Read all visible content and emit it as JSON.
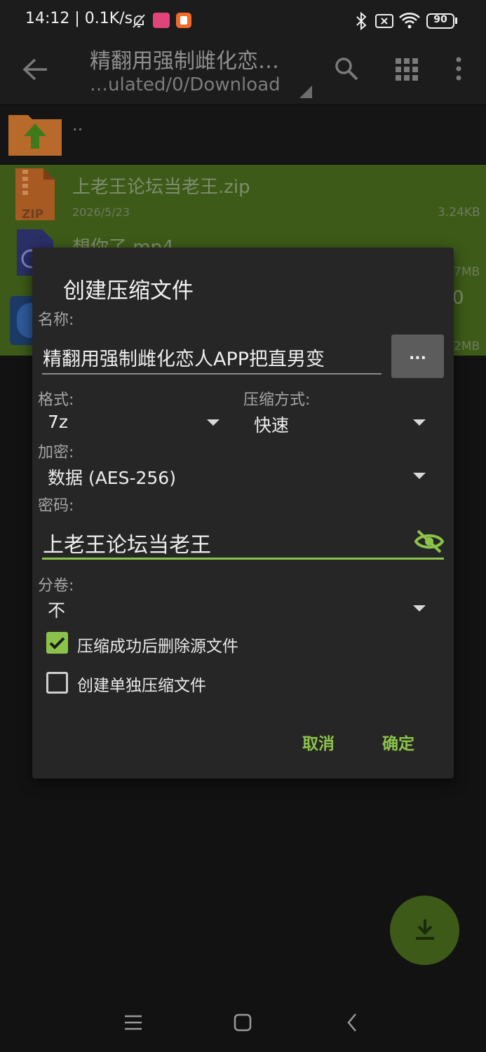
{
  "status_bar": {
    "time_speed": "14:12 | 0.1K/s",
    "battery": "90",
    "icons": [
      "bell-off-icon",
      "app-badge-icon",
      "app-icon-orange",
      "bluetooth-icon",
      "sim-x-icon",
      "wifi-icon",
      "battery-icon"
    ]
  },
  "app_bar": {
    "title": "精翻用强制雌化恋…",
    "subtitle": "…ulated/0/Download"
  },
  "files": {
    "parent_label": "..",
    "items": [
      {
        "name": "上老王论坛当老王.zip",
        "date": "2026/5/23",
        "size": "3.24KB",
        "icon_label": "ZIP"
      },
      {
        "name": "想你了.mp4",
        "size": "7MB"
      },
      {
        "name": "",
        "size_partial": "0",
        "size": "2MB"
      }
    ]
  },
  "dialog": {
    "title": "创建压缩文件",
    "name_label": "名称:",
    "name_value": "精翻用强制雌化恋人APP把直男变",
    "browse_label": "...",
    "format_label": "格式:",
    "format_value": "7z",
    "method_label": "压缩方式:",
    "method_value": "快速",
    "encrypt_label": "加密:",
    "encrypt_value": "数据 (AES-256)",
    "password_label": "密码:",
    "password_value": "上老王论坛当老王",
    "split_label": "分卷:",
    "split_value": "不",
    "delete_after_label": "压缩成功后删除源文件",
    "delete_after_checked": true,
    "separate_label": "创建单独压缩文件",
    "separate_checked": false,
    "cancel_label": "取消",
    "ok_label": "确定"
  },
  "colors": {
    "accent": "#8bc34a",
    "selected_row": "#3d5a18",
    "dialog_bg": "#262626"
  }
}
